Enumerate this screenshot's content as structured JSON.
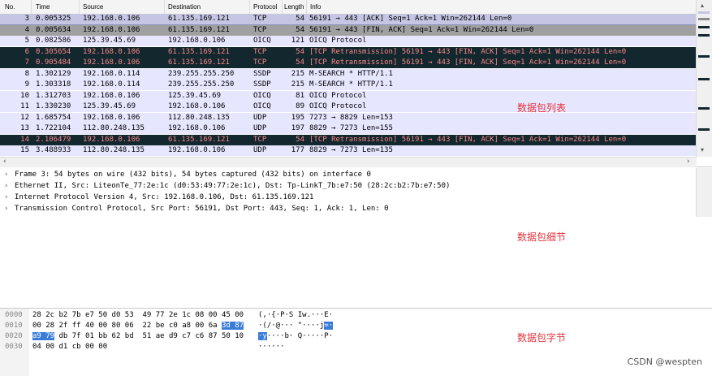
{
  "packet_list": {
    "columns": {
      "no": "No.",
      "time": "Time",
      "source": "Source",
      "destination": "Destination",
      "protocol": "Protocol",
      "length": "Length",
      "info": "Info"
    },
    "rows": [
      {
        "no": "3",
        "time": "0.005325",
        "src": "192.168.0.106",
        "dst": "61.135.169.121",
        "proto": "TCP",
        "len": "54",
        "info": "56191 → 443 [ACK] Seq=1 Ack=1 Win=262144 Len=0",
        "style": "selected"
      },
      {
        "no": "4",
        "time": "0.005634",
        "src": "192.168.0.106",
        "dst": "61.135.169.121",
        "proto": "TCP",
        "len": "54",
        "info": "56191 → 443 [FIN, ACK] Seq=1 Ack=1 Win=262144 Len=0",
        "style": "tcp-fin"
      },
      {
        "no": "5",
        "time": "0.082586",
        "src": "125.39.45.69",
        "dst": "192.168.0.106",
        "proto": "OICQ",
        "len": "121",
        "info": "OICQ Protocol",
        "style": "light"
      },
      {
        "no": "6",
        "time": "0.305654",
        "src": "192.168.0.106",
        "dst": "61.135.169.121",
        "proto": "TCP",
        "len": "54",
        "info": "[TCP Retransmission] 56191 → 443 [FIN, ACK] Seq=1 Ack=1 Win=262144 Len=0",
        "style": "bad"
      },
      {
        "no": "7",
        "time": "0.905484",
        "src": "192.168.0.106",
        "dst": "61.135.169.121",
        "proto": "TCP",
        "len": "54",
        "info": "[TCP Retransmission] 56191 → 443 [FIN, ACK] Seq=1 Ack=1 Win=262144 Len=0",
        "style": "bad"
      },
      {
        "no": "8",
        "time": "1.302129",
        "src": "192.168.0.114",
        "dst": "239.255.255.250",
        "proto": "SSDP",
        "len": "215",
        "info": "M-SEARCH * HTTP/1.1",
        "style": "light"
      },
      {
        "no": "9",
        "time": "1.303318",
        "src": "192.168.0.114",
        "dst": "239.255.255.250",
        "proto": "SSDP",
        "len": "215",
        "info": "M-SEARCH * HTTP/1.1",
        "style": "light"
      },
      {
        "no": "10",
        "time": "1.312703",
        "src": "192.168.0.106",
        "dst": "125.39.45.69",
        "proto": "OICQ",
        "len": "81",
        "info": "OICQ Protocol",
        "style": "light"
      },
      {
        "no": "11",
        "time": "1.330230",
        "src": "125.39.45.69",
        "dst": "192.168.0.106",
        "proto": "OICQ",
        "len": "89",
        "info": "OICQ Protocol",
        "style": "light"
      },
      {
        "no": "12",
        "time": "1.685754",
        "src": "192.168.0.106",
        "dst": "112.80.248.135",
        "proto": "UDP",
        "len": "195",
        "info": "7273 → 8829 Len=153",
        "style": "light"
      },
      {
        "no": "13",
        "time": "1.722104",
        "src": "112.80.248.135",
        "dst": "192.168.0.106",
        "proto": "UDP",
        "len": "197",
        "info": "8829 → 7273 Len=155",
        "style": "light"
      },
      {
        "no": "14",
        "time": "2.106479",
        "src": "192.168.0.106",
        "dst": "61.135.169.121",
        "proto": "TCP",
        "len": "54",
        "info": "[TCP Retransmission] 56191 → 443 [FIN, ACK] Seq=1 Ack=1 Win=262144 Len=0",
        "style": "bad"
      },
      {
        "no": "15",
        "time": "3.488933",
        "src": "112.80.248.135",
        "dst": "192.168.0.106",
        "proto": "UDP",
        "len": "177",
        "info": "8829 → 7273 Len=135",
        "style": "light"
      }
    ]
  },
  "details": [
    "Frame 3: 54 bytes on wire (432 bits), 54 bytes captured (432 bits) on interface 0",
    "Ethernet II, Src: LiteonTe_77:2e:1c (d0:53:49:77:2e:1c), Dst: Tp-LinkT_7b:e7:50 (28:2c:b2:7b:e7:50)",
    "Internet Protocol Version 4, Src: 192.168.0.106, Dst: 61.135.169.121",
    "Transmission Control Protocol, Src Port: 56191, Dst Port: 443, Seq: 1, Ack: 1, Len: 0"
  ],
  "bytes": [
    {
      "off": "0000",
      "hex": [
        {
          "t": "28 2c b2 7b e7 50 d0 53  49 77 2e 1c 08 00 45 00",
          "h": false
        }
      ],
      "ascii": [
        {
          "t": "(,·{·P·S Iw.···E·",
          "h": false
        }
      ]
    },
    {
      "off": "0010",
      "hex": [
        {
          "t": "00 28 2f ff 40 00 80 06  22 be c0 a8 00 6a ",
          "h": false
        },
        {
          "t": "3d 87",
          "h": true
        }
      ],
      "ascii": [
        {
          "t": "·(/·@··· \"····j",
          "h": false
        },
        {
          "t": "=·",
          "h": true
        }
      ]
    },
    {
      "off": "0020",
      "hex": [
        {
          "t": "a9 79",
          "h": true
        },
        {
          "t": " db 7f 01 bb 62 bd  51 ae d9 c7 c6 87 50 10",
          "h": false
        }
      ],
      "ascii": [
        {
          "t": "·y",
          "h": true
        },
        {
          "t": "····b· Q·····P·",
          "h": false
        }
      ]
    },
    {
      "off": "0030",
      "hex": [
        {
          "t": "04 00 d1 cb 00 00",
          "h": false
        }
      ],
      "ascii": [
        {
          "t": "······",
          "h": false
        }
      ]
    }
  ],
  "annotations": {
    "list": "数据包列表",
    "details": "数据包细节",
    "bytes": "数据包字节"
  },
  "watermark": "CSDN @wespten",
  "colors": {
    "selected": "#c6c6e4",
    "tcp-fin": "#a0a0a0",
    "light": "#e7e6ff",
    "bad": "#12272e",
    "bad_text": "#f78787",
    "highlight": "#3a7dd9",
    "annotation": "#e6333a"
  }
}
